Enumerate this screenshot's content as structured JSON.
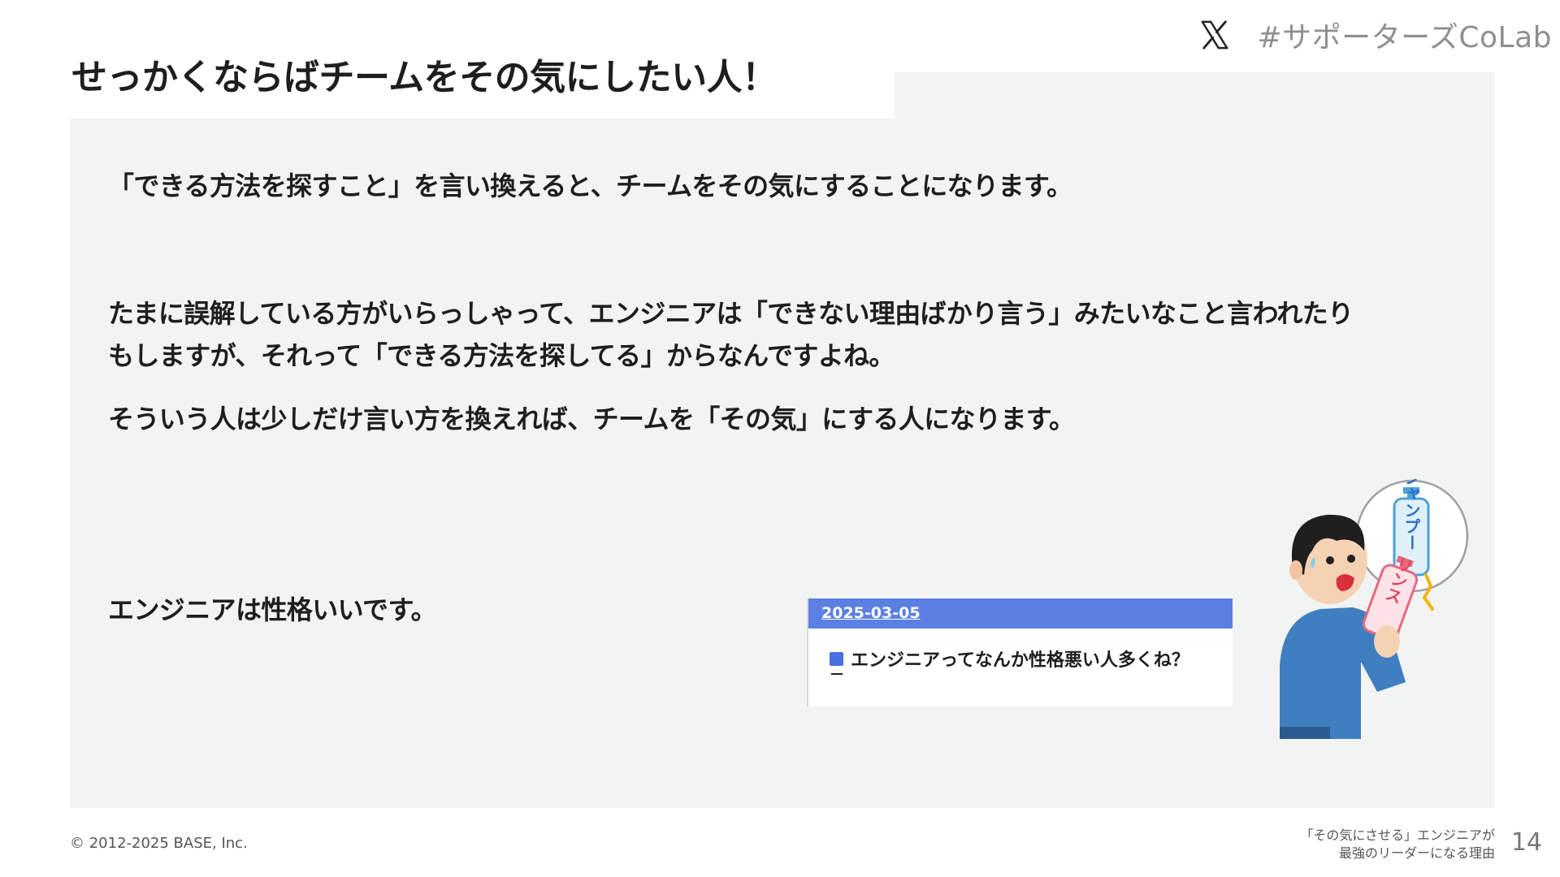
{
  "slide": {
    "title": "せっかくならばチームをその気にしたい人！",
    "hashtag": "#サポーターズCoLab",
    "paragraphs": {
      "p1": "「できる方法を探すこと」を言い換えると、チームをその気にすることになります。",
      "p2_line1": "たまに誤解している方がいらっしゃって、エンジニアは「できない理由ばかり言う」みたいなこと言われたり",
      "p2_line2": "もしますが、それって「できる方法を探してる」からなんですよね。",
      "p3": "そういう人は少しだけ言い方を換えれば、チームを「その気」にする人になります。",
      "p4": "エンジニアは性格いいです。"
    },
    "card": {
      "date": "2025-03-05",
      "text": "エンジニアってなんか性格悪い人多くね？"
    },
    "illustration": {
      "bubble_label": "シャンプー",
      "bottle_label": "リンス"
    },
    "footer": {
      "copyright": "© 2012-2025 BASE, Inc.",
      "subtitle_line1": "「その気にさせる」エンジニアが",
      "subtitle_line2": "最強のリーダーになる理由",
      "page_number": "14"
    }
  },
  "colors": {
    "panel_bg": "#f2f4f3",
    "card_header": "#5b7fe3",
    "hashtag_text": "#8f8f8f"
  },
  "icons": [
    "x-logo-icon",
    "square-bullet-icon"
  ]
}
